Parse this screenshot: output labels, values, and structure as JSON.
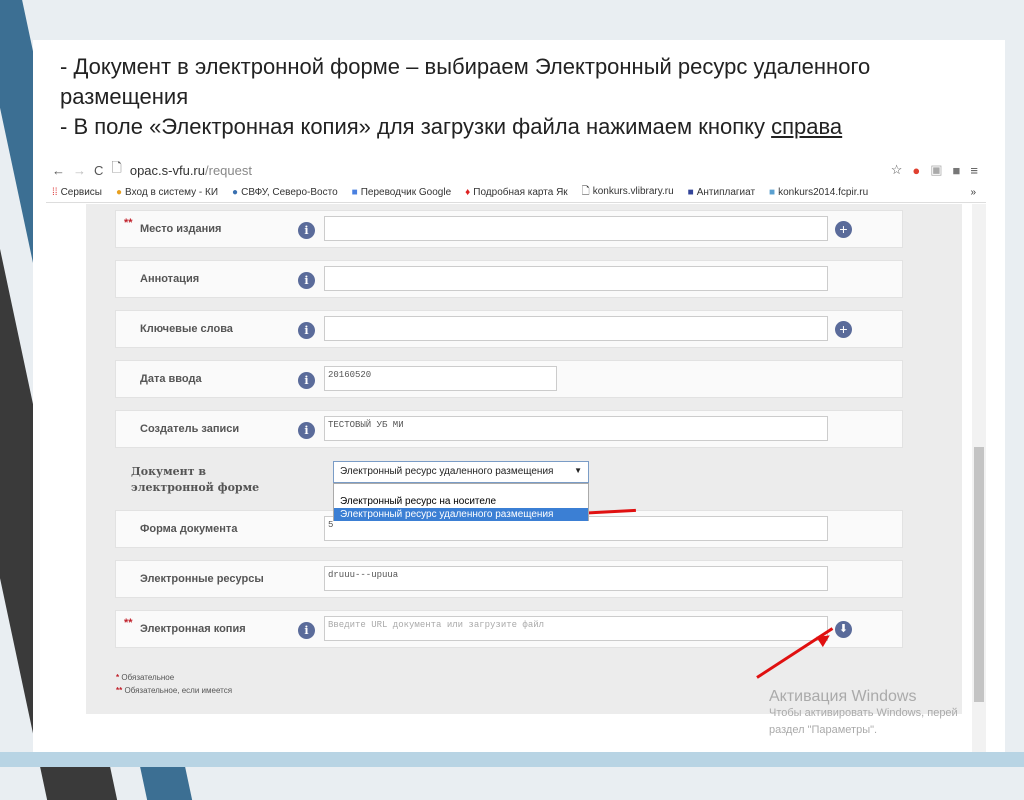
{
  "slide": {
    "line1": "- Документ в электронной форме – выбираем Электронный ресурс удаленного",
    "line2": "размещения",
    "line3_pre": "- В поле «Электронная копия» для загрузки файла нажимаем кнопку ",
    "line3_link": "справа"
  },
  "browser": {
    "url_host": "opac.s-vfu.ru",
    "url_path": "/request",
    "bookmarks": [
      "Сервисы",
      "Вход в систему - КИ",
      "СВФУ, Северо-Восто",
      "Переводчик Google",
      "Подробная карта Як",
      "konkurs.vlibrary.ru",
      "Антиплагиат",
      "konkurs2014.fcpir.ru"
    ],
    "more": "»"
  },
  "form": {
    "rows": [
      {
        "label": "Место издания",
        "req": "**",
        "value": ""
      },
      {
        "label": "Аннотация",
        "value": ""
      },
      {
        "label": "Ключевые слова",
        "value": ""
      },
      {
        "label": "Дата ввода",
        "value": "20160520"
      },
      {
        "label": "Создатель записи",
        "value": "ТЕСТОВЫЙ УБ МИ"
      },
      {
        "label": "Форма документа",
        "value": "5"
      },
      {
        "label": "Электронные ресурсы",
        "value": "druuu---upuua"
      },
      {
        "label": "Электронная копия",
        "req": "**",
        "placeholder": "Введите URL документа или загрузите файл"
      }
    ],
    "doc_label": "Документ в электронной форме",
    "doc_selected": "Электронный ресурс удаленного размещения",
    "doc_options": [
      "Электронный ресурс на носителе",
      "Электронный ресурс удаленного размещения"
    ],
    "legend": [
      {
        "mark": "*",
        "text": "Обязательное"
      },
      {
        "mark": "**",
        "text": "Обязательное, если имеется"
      }
    ]
  },
  "watermark": {
    "title": "Активация Windows",
    "line1": "Чтобы активировать Windows, перей",
    "line2": "раздел \"Параметры\"."
  },
  "colors": {
    "arrow": "#e01010",
    "selected": "#3b7fd4",
    "required": "#c0202a"
  }
}
